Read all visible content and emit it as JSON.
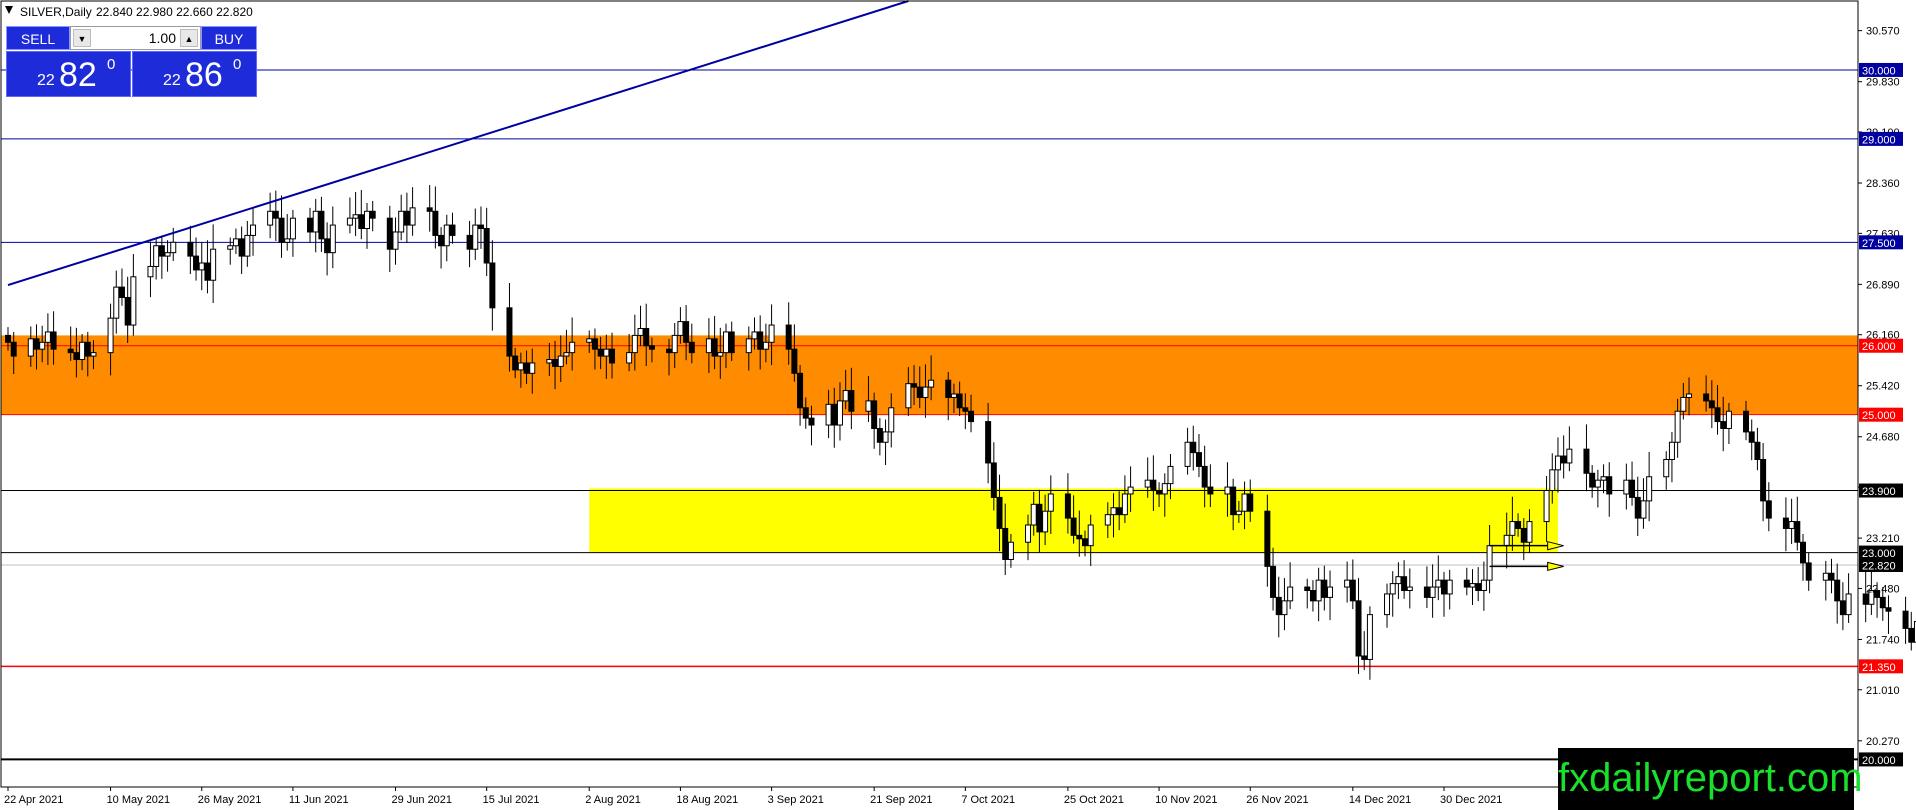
{
  "header": {
    "symbol": "SILVER,Daily",
    "ohlc": "22.840 22.980 22.660 22.820"
  },
  "trade_panel": {
    "sell_label": "SELL",
    "buy_label": "BUY",
    "lot_value": "1.00",
    "spin_down_icon": "triangle-down-icon",
    "spin_up_icon": "triangle-up-icon",
    "sell_price": {
      "prefix": "22",
      "main": "82",
      "sup": "0"
    },
    "buy_price": {
      "prefix": "22",
      "main": "86",
      "sup": "0"
    }
  },
  "watermark": "fxdailyreport.com",
  "colors": {
    "orange_zone": "#ff8c00",
    "yellow_zone": "#ffff00",
    "blue_line": "#0000a0",
    "red_line": "#ff0000",
    "trade_panel": "#1e2bd8",
    "watermark_text": "#19e02b"
  },
  "chart_data": {
    "type": "candlestick",
    "symbol": "SILVER",
    "timeframe": "Daily",
    "ylim": [
      19.6,
      31.0
    ],
    "y_ticks": [
      "30.570",
      "29.830",
      "29.100",
      "28.360",
      "27.630",
      "26.890",
      "26.160",
      "25.420",
      "24.680",
      "23.950",
      "23.210",
      "22.480",
      "21.740",
      "21.010",
      "20.270"
    ],
    "x_ticks": [
      "22 Apr 2021",
      "10 May 2021",
      "26 May 2021",
      "11 Jun 2021",
      "29 Jun 2021",
      "15 Jul 2021",
      "2 Aug 2021",
      "18 Aug 2021",
      "3 Sep 2021",
      "21 Sep 2021",
      "7 Oct 2021",
      "25 Oct 2021",
      "10 Nov 2021",
      "26 Nov 2021",
      "14 Dec 2021",
      "30 Dec 2021"
    ],
    "zones": [
      {
        "from": 25.0,
        "to": 26.15,
        "color": "#ff8c00"
      },
      {
        "from": 23.0,
        "to": 23.93,
        "color": "#ffff00",
        "x_start": "2 Aug 2021",
        "x_end": "19 Jan 2022"
      }
    ],
    "horizontal_levels": [
      {
        "price": 30.0,
        "label": "30.000",
        "color": "#0000a0",
        "width": 1
      },
      {
        "price": 29.0,
        "label": "29.000",
        "color": "#0000a0",
        "width": 1
      },
      {
        "price": 27.5,
        "label": "27.500",
        "color": "#0000a0",
        "width": 1
      },
      {
        "price": 26.0,
        "label": "26.000",
        "color": "#ff0000",
        "width": 1
      },
      {
        "price": 25.0,
        "label": "25.000",
        "color": "#ff0000",
        "width": 1
      },
      {
        "price": 23.9,
        "label": "23.900",
        "color": "#000000",
        "width": 1
      },
      {
        "price": 23.0,
        "label": "23.000",
        "color": "#000000",
        "width": 1
      },
      {
        "price": 22.82,
        "label": "22.820",
        "color": "#c0c0c0",
        "width": 1
      },
      {
        "price": 21.35,
        "label": "21.350",
        "color": "#ff0000",
        "width": 1.5
      },
      {
        "price": 20.0,
        "label": "20.000",
        "color": "#000000",
        "width": 2
      }
    ],
    "trendline": {
      "color": "#0000a0",
      "from": {
        "x": "22 Apr 2021",
        "price": 26.88
      },
      "to": {
        "x": "27 Sep 2021",
        "price": 31.0
      }
    },
    "arrows": [
      {
        "x_start": "7 Jan 2022",
        "x_end": "20 Jan 2022",
        "price": 23.1,
        "color": "#ffff00"
      },
      {
        "x_start": "7 Jan 2022",
        "x_end": "20 Jan 2022",
        "price": 22.8,
        "color": "#ffff00"
      }
    ],
    "candle_series": {
      "start_date": "22 Apr 2021",
      "closes": [
        26.05,
        25.85,
        26.1,
        25.95,
        26.05,
        26.2,
        25.95,
        25.9,
        25.8,
        26.05,
        25.85,
        25.9,
        26.4,
        26.85,
        26.7,
        26.3,
        27.0,
        27.15,
        27.45,
        27.3,
        27.35,
        27.5,
        27.3,
        27.1,
        27.2,
        26.95,
        27.4,
        27.45,
        27.55,
        27.3,
        27.6,
        27.75,
        27.95,
        27.85,
        27.5,
        27.55,
        27.85,
        27.65,
        27.95,
        27.55,
        27.35,
        27.75,
        27.85,
        27.9,
        27.7,
        27.95,
        27.85,
        27.4,
        27.65,
        27.95,
        27.75,
        28.0,
        27.95,
        27.6,
        27.45,
        27.75,
        27.6,
        27.4,
        27.75,
        27.7,
        27.2,
        26.55,
        25.85,
        25.65,
        25.75,
        25.6,
        25.75,
        25.8,
        25.7,
        25.85,
        25.9,
        26.05,
        26.1,
        25.95,
        25.85,
        25.95,
        25.75,
        25.9,
        26.15,
        26.25,
        26.0,
        25.95,
        25.9,
        26.15,
        26.35,
        26.05,
        25.9,
        26.1,
        25.85,
        25.9,
        26.2,
        25.9,
        26.1,
        26.2,
        25.95,
        26.05,
        26.3,
        25.95,
        25.6,
        25.1,
        24.95,
        24.85,
        25.15,
        24.85,
        25.2,
        25.35,
        25.05,
        25.2,
        24.8,
        24.6,
        24.75,
        25.1,
        25.45,
        25.4,
        25.25,
        25.4,
        25.5,
        25.25,
        25.3,
        25.1,
        25.05,
        24.9,
        24.3,
        23.8,
        23.35,
        22.9,
        23.15,
        23.4,
        23.7,
        23.3,
        23.6,
        23.85,
        23.5,
        23.25,
        23.2,
        23.1,
        23.4,
        23.55,
        23.65,
        23.55,
        23.85,
        23.95,
        24.05,
        23.9,
        23.85,
        24.0,
        24.25,
        24.6,
        24.45,
        24.25,
        23.95,
        23.85,
        23.95,
        23.55,
        23.6,
        23.85,
        23.6,
        22.8,
        22.35,
        22.1,
        22.3,
        22.5,
        22.45,
        22.3,
        22.6,
        22.35,
        22.5,
        22.6,
        22.3,
        21.5,
        21.45,
        22.1,
        22.4,
        22.55,
        22.65,
        22.45,
        22.5,
        22.35,
        22.5,
        22.6,
        22.4,
        22.6,
        22.5,
        22.55,
        22.45,
        22.6,
        23.1,
        23.25,
        23.45,
        23.35,
        23.15,
        23.45,
        23.9,
        24.2,
        24.4,
        24.3,
        24.5,
        24.15,
        23.95,
        24.05,
        24.1,
        23.85,
        24.05,
        23.8,
        23.5,
        23.75,
        24.1,
        24.35,
        24.6,
        25.05,
        25.25,
        25.3,
        25.2,
        25.1,
        24.9,
        24.8,
        25.05,
        24.75,
        24.6,
        24.35,
        23.75,
        23.5,
        23.35,
        23.45,
        23.15,
        22.85,
        22.6,
        22.7,
        22.6,
        22.3,
        22.1,
        22.4,
        22.25,
        22.45,
        22.35,
        22.2,
        22.15,
        21.9,
        21.7,
        22.0,
        22.2,
        21.95,
        22.25,
        21.75,
        22.35,
        22.4,
        22.55,
        22.7,
        22.8,
        22.9,
        23.0,
        22.95,
        22.85,
        23.05,
        23.0,
        22.95,
        22.9,
        23.1,
        23.2,
        23.15,
        22.82
      ]
    }
  }
}
